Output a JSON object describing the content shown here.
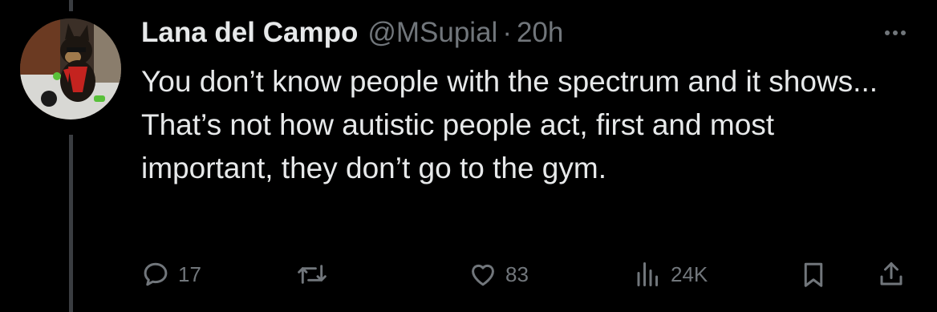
{
  "tweet": {
    "author": {
      "display_name": "Lana del Campo",
      "handle": "@MSupial",
      "avatar": "dog-avatar"
    },
    "separator": "·",
    "timestamp": "20h",
    "text_lines": [
      "You don’t know people with the spectrum and it shows...",
      "That’s not how autistic people act, first and most important, they don’t go to the gym."
    ],
    "actions": {
      "reply": {
        "icon": "reply-icon",
        "count": "17"
      },
      "retweet": {
        "icon": "retweet-icon",
        "count": ""
      },
      "like": {
        "icon": "heart-icon",
        "count": "83"
      },
      "views": {
        "icon": "views-icon",
        "count": "24K"
      },
      "bookmark": {
        "icon": "bookmark-icon"
      },
      "share": {
        "icon": "share-icon"
      }
    }
  },
  "colors": {
    "background": "#000000",
    "primary_text": "#e7e9ea",
    "secondary_text": "#71767b",
    "thread_line": "#3a3d41"
  }
}
